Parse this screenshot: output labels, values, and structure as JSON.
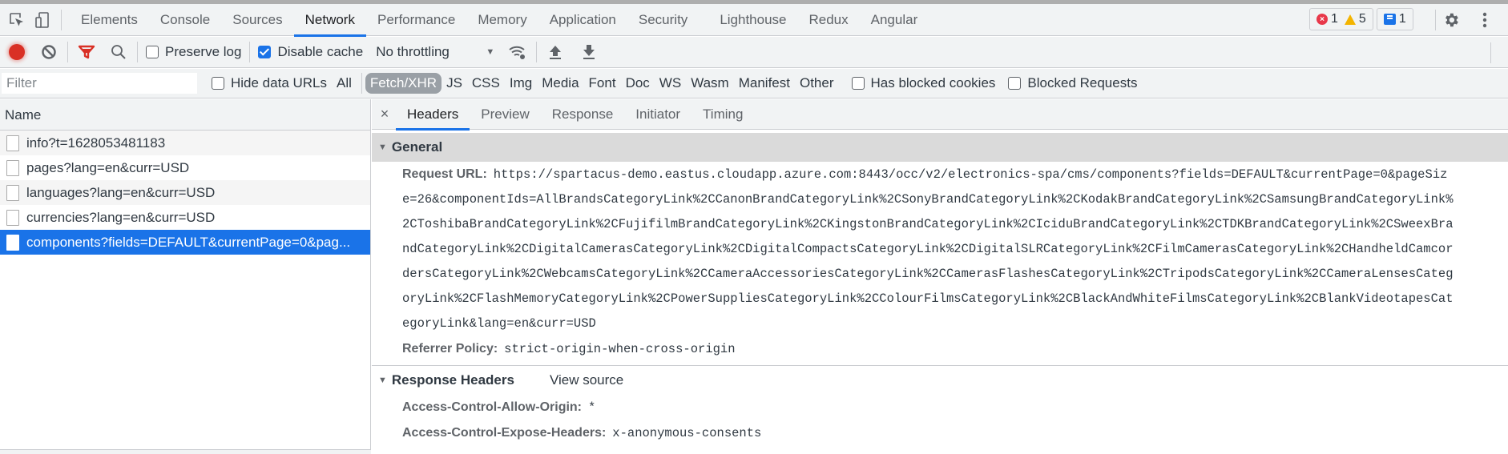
{
  "devtools": {
    "panel_tabs": [
      {
        "label": "Elements",
        "active": false
      },
      {
        "label": "Console",
        "active": false
      },
      {
        "label": "Sources",
        "active": false
      },
      {
        "label": "Network",
        "active": true
      },
      {
        "label": "Performance",
        "active": false
      },
      {
        "label": "Memory",
        "active": false
      },
      {
        "label": "Application",
        "active": false
      },
      {
        "label": "Security",
        "active": false
      },
      {
        "label": "Lighthouse",
        "active": false
      },
      {
        "label": "Redux",
        "active": false
      },
      {
        "label": "Angular",
        "active": false
      }
    ],
    "issues": {
      "errors": "1",
      "warnings": "5",
      "messages": "1"
    }
  },
  "toolbar": {
    "preserve_log": {
      "label": "Preserve log",
      "checked": false
    },
    "disable_cache": {
      "label": "Disable cache",
      "checked": true
    },
    "throttling": "No throttling"
  },
  "filter": {
    "placeholder": "Filter",
    "value": "",
    "hide_data_urls": {
      "label": "Hide data URLs",
      "checked": false
    },
    "all_label": "All",
    "types": [
      "Fetch/XHR",
      "JS",
      "CSS",
      "Img",
      "Media",
      "Font",
      "Doc",
      "WS",
      "Wasm",
      "Manifest",
      "Other"
    ],
    "active_type": "Fetch/XHR",
    "has_blocked_cookies": {
      "label": "Has blocked cookies",
      "checked": false
    },
    "blocked_requests": {
      "label": "Blocked Requests",
      "checked": false
    }
  },
  "requests": {
    "column_header": "Name",
    "items": [
      {
        "name": "info?t=1628053481183",
        "selected": false
      },
      {
        "name": "pages?lang=en&curr=USD",
        "selected": false
      },
      {
        "name": "languages?lang=en&curr=USD",
        "selected": false
      },
      {
        "name": "currencies?lang=en&curr=USD",
        "selected": false
      },
      {
        "name": "components?fields=DEFAULT&currentPage=0&pag...",
        "selected": true
      }
    ]
  },
  "details": {
    "tabs": [
      {
        "label": "Headers",
        "active": true
      },
      {
        "label": "Preview",
        "active": false
      },
      {
        "label": "Response",
        "active": false
      },
      {
        "label": "Initiator",
        "active": false
      },
      {
        "label": "Timing",
        "active": false
      }
    ],
    "general": {
      "title": "General",
      "request_url_label": "Request URL:",
      "request_url_lines": [
        "https://spartacus-demo.eastus.cloudapp.azure.com:8443/occ/v2/electronics-spa/cms/components?fields=DEFAULT&currentPage=0&pageSiz",
        "e=26&componentIds=AllBrandsCategoryLink%2CCanonBrandCategoryLink%2CSonyBrandCategoryLink%2CKodakBrandCategoryLink%2CSamsungBrandCategoryLink%",
        "2CToshibaBrandCategoryLink%2CFujifilmBrandCategoryLink%2CKingstonBrandCategoryLink%2CIciduBrandCategoryLink%2CTDKBrandCategoryLink%2CSweexBra",
        "ndCategoryLink%2CDigitalCamerasCategoryLink%2CDigitalCompactsCategoryLink%2CDigitalSLRCategoryLink%2CFilmCamerasCategoryLink%2CHandheldCamcor",
        "dersCategoryLink%2CWebcamsCategoryLink%2CCameraAccessoriesCategoryLink%2CCamerasFlashesCategoryLink%2CTripodsCategoryLink%2CCameraLensesCateg",
        "oryLink%2CFlashMemoryCategoryLink%2CPowerSuppliesCategoryLink%2CColourFilmsCategoryLink%2CBlackAndWhiteFilmsCategoryLink%2CBlankVideotapesCat",
        "egoryLink&lang=en&curr=USD"
      ],
      "referrer_policy_label": "Referrer Policy:",
      "referrer_policy_value": "strict-origin-when-cross-origin"
    },
    "response_headers": {
      "title": "Response Headers",
      "view_source": "View source",
      "items": [
        {
          "key": "Access-Control-Allow-Origin:",
          "value": "*"
        },
        {
          "key": "Access-Control-Expose-Headers:",
          "value": "x-anonymous-consents"
        }
      ]
    }
  }
}
